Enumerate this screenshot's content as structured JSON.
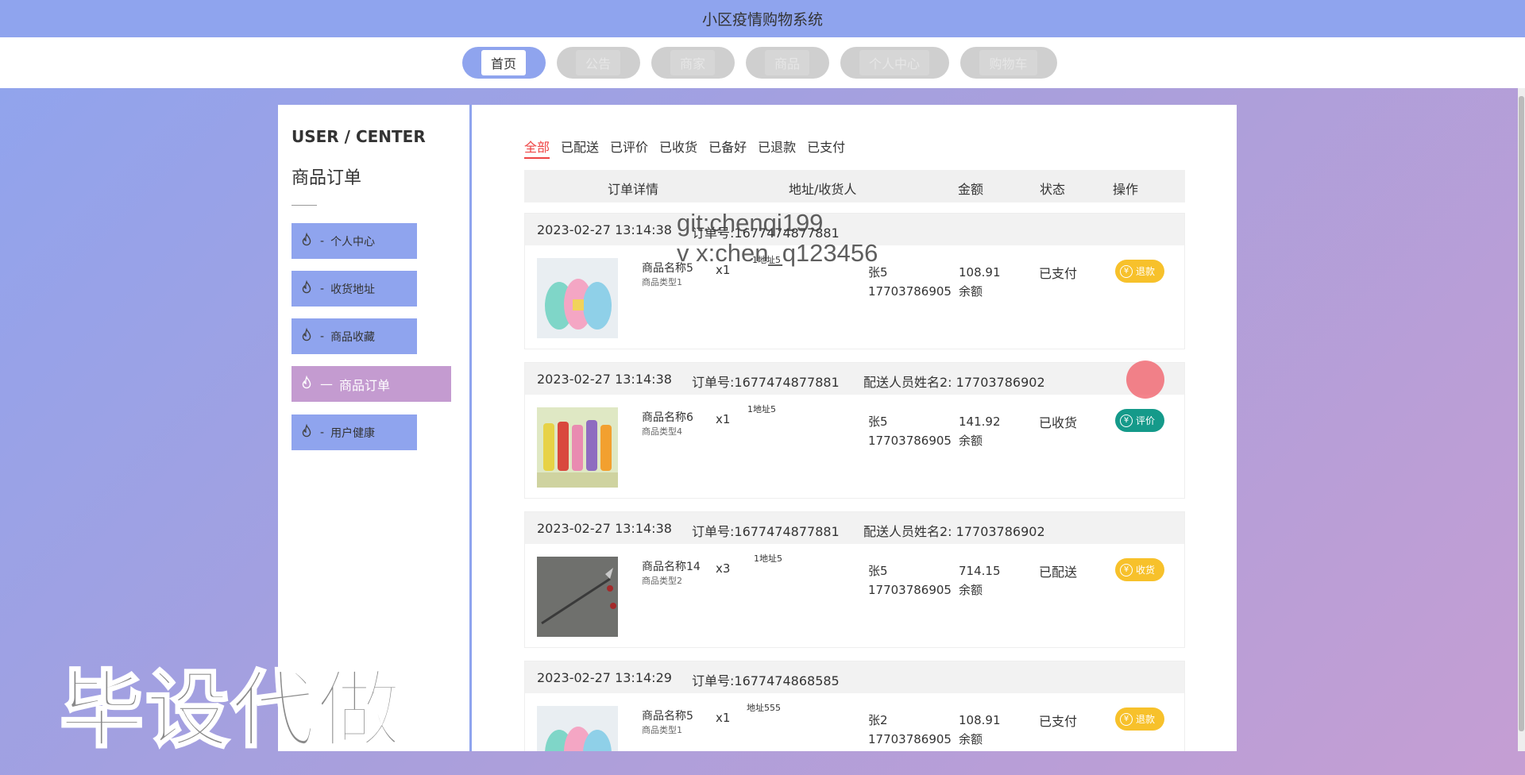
{
  "app": {
    "title": "小区疫情购物系统"
  },
  "nav": [
    {
      "label": "首页",
      "active": true
    },
    {
      "label": "公告",
      "active": false
    },
    {
      "label": "商家",
      "active": false
    },
    {
      "label": "商品",
      "active": false
    },
    {
      "label": "个人中心",
      "active": false
    },
    {
      "label": "购物车",
      "active": false
    }
  ],
  "sidebar": {
    "title": "USER / CENTER",
    "subtitle": "商品订单",
    "items": [
      {
        "label": "个人中心",
        "icon": "fire-icon"
      },
      {
        "label": "收货地址",
        "icon": "fire-icon"
      },
      {
        "label": "商品收藏",
        "icon": "fire-icon"
      },
      {
        "label": "商品订单",
        "icon": "fire-icon",
        "active": true
      },
      {
        "label": "用户健康",
        "icon": "fire-icon"
      }
    ]
  },
  "tabs": [
    "全部",
    "已配送",
    "已评价",
    "已收货",
    "已备好",
    "已退款",
    "已支付"
  ],
  "table": {
    "headers": [
      "订单详情",
      "地址/收货人",
      "金额",
      "状态",
      "操作"
    ]
  },
  "orders": [
    {
      "time": "2023-02-27 13:14:38",
      "order_no": "订单号:1677474877881",
      "courier": "",
      "product_name": "商品名称5",
      "product_type": "商品类型1",
      "qty": "x1",
      "address": "1地址5",
      "receiver": "张5",
      "phone": "17703786905",
      "amount": "108.91",
      "pay": "余额",
      "status": "已支付",
      "action": "退款",
      "action_color": "yellow",
      "image": "cups"
    },
    {
      "time": "2023-02-27 13:14:38",
      "order_no": "订单号:1677474877881",
      "courier": "配送人员姓名2:  17703786902",
      "product_name": "商品名称6",
      "product_type": "商品类型4",
      "qty": "x1",
      "address": "1地址5",
      "receiver": "张5",
      "phone": "17703786905",
      "amount": "141.92",
      "pay": "余额",
      "status": "已收货",
      "action": "评价",
      "action_color": "teal",
      "image": "bottles"
    },
    {
      "time": "2023-02-27 13:14:38",
      "order_no": "订单号:1677474877881",
      "courier": "配送人员姓名2:  17703786902",
      "product_name": "商品名称14",
      "product_type": "商品类型2",
      "qty": "x3",
      "address": "1地址5",
      "receiver": "张5",
      "phone": "17703786905",
      "amount": "714.15",
      "pay": "余额",
      "status": "已配送",
      "action": "收货",
      "action_color": "yellow",
      "image": "spear"
    },
    {
      "time": "2023-02-27 13:14:29",
      "order_no": "订单号:1677474868585",
      "courier": "",
      "product_name": "商品名称5",
      "product_type": "商品类型1",
      "qty": "x1",
      "address": "地址555",
      "receiver": "张2",
      "phone": "17703786905",
      "amount": "108.91",
      "pay": "余额",
      "status": "已支付",
      "action": "退款",
      "action_color": "yellow",
      "image": "cups"
    }
  ],
  "overlays": {
    "git_line1": "git:chenqi199",
    "git_line2": "v x:chen_q123456",
    "big_text": "毕设代做"
  }
}
